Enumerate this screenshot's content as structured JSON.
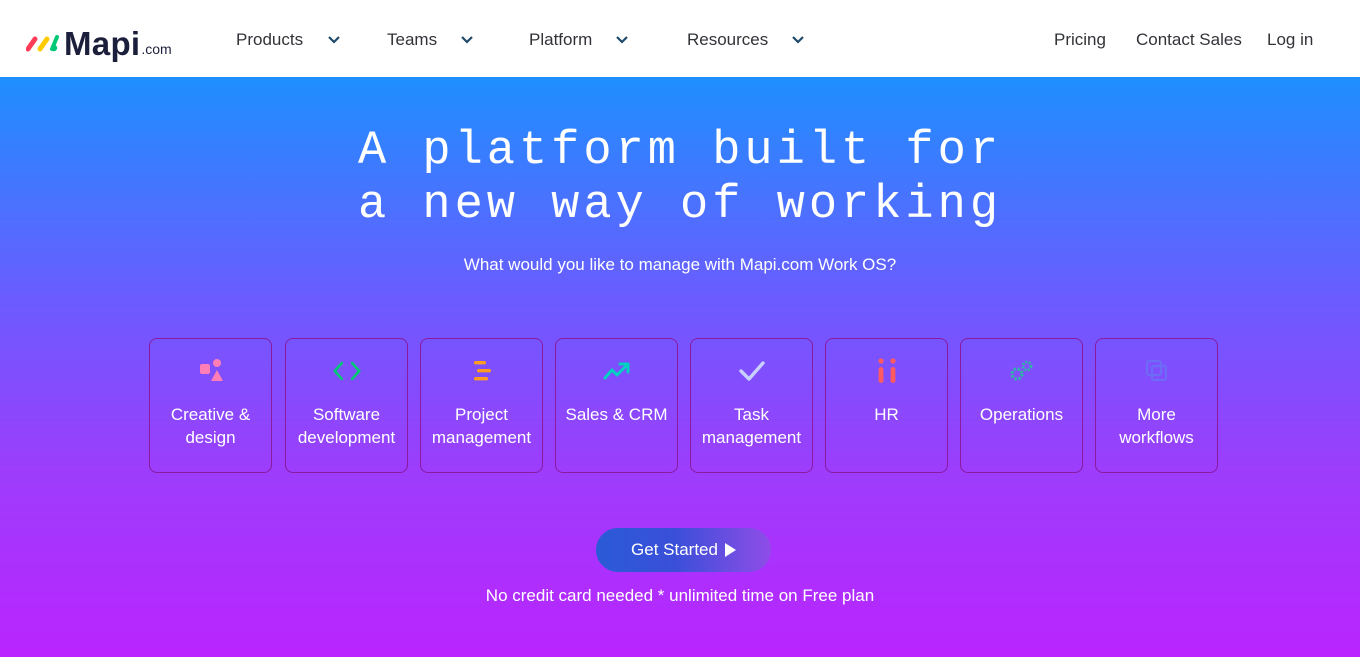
{
  "brand": {
    "name": "Mapi",
    "suffix": ".com"
  },
  "nav": {
    "menus": [
      {
        "label": "Products"
      },
      {
        "label": "Teams"
      },
      {
        "label": "Platform"
      },
      {
        "label": "Resources"
      }
    ],
    "links": [
      {
        "label": "Pricing"
      },
      {
        "label": "Contact Sales"
      },
      {
        "label": "Log in"
      }
    ]
  },
  "hero": {
    "headline_line1": "A platform built for",
    "headline_line2": "a new way of working",
    "subtitle": "What would you like to manage with Mapi.com Work OS?",
    "cards": [
      {
        "line1": "Creative &",
        "line2": "design",
        "icon": "shapes-icon"
      },
      {
        "line1": "Software",
        "line2": "development",
        "icon": "code-icon"
      },
      {
        "line1": "Project",
        "line2": "management",
        "icon": "gantt-icon"
      },
      {
        "line1": "Sales & CRM",
        "line2": "",
        "icon": "trend-up-icon"
      },
      {
        "line1": "Task",
        "line2": "management",
        "icon": "check-icon"
      },
      {
        "line1": "HR",
        "line2": "",
        "icon": "people-icon"
      },
      {
        "line1": "Operations",
        "line2": "",
        "icon": "gears-icon"
      },
      {
        "line1": "More",
        "line2": "workflows",
        "icon": "layers-icon"
      }
    ],
    "cta_label": "Get Started",
    "note": "No credit card needed * unlimited time on Free plan"
  },
  "colors": {
    "gradient_top": "#1e8fff",
    "gradient_bottom": "#ba24ff",
    "card_border": "#8a1aa0",
    "brand_dark": "#1c1f3b"
  }
}
